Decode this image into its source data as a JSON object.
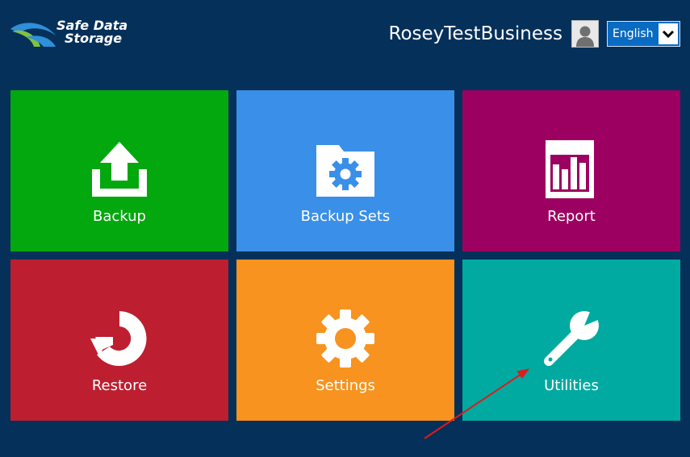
{
  "logo": {
    "line1": "Safe Data",
    "line2": "Storage"
  },
  "header": {
    "username": "RoseyTestBusiness",
    "language": "English"
  },
  "tiles": [
    {
      "label": "Backup",
      "color": "#03a80f",
      "icon": "upload-icon"
    },
    {
      "label": "Backup Sets",
      "color": "#3a8fe8",
      "icon": "folder-gear-icon"
    },
    {
      "label": "Report",
      "color": "#9c0060",
      "icon": "bar-chart-icon"
    },
    {
      "label": "Restore",
      "color": "#bd1e30",
      "icon": "restore-icon"
    },
    {
      "label": "Settings",
      "color": "#f7931e",
      "icon": "gear-icon"
    },
    {
      "label": "Utilities",
      "color": "#00aaa0",
      "icon": "wrench-icon"
    }
  ],
  "colors": {
    "background": "#05305a",
    "language_select": "#0a6bc2",
    "annotation_arrow": "#e01b1b"
  }
}
